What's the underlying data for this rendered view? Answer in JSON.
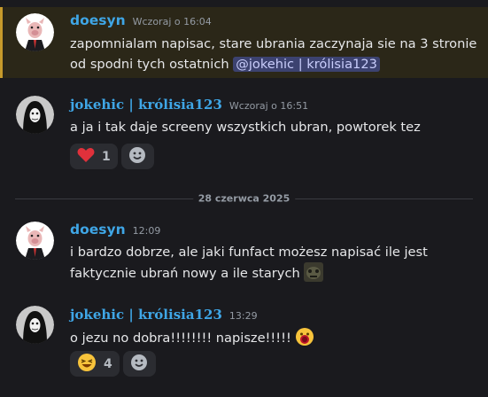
{
  "messages": [
    {
      "author": "doesyn",
      "time": "Wczoraj o 16:04",
      "text": "zapomnialam napisac, stare ubrania zaczynaja sie na 3 stronie od spodni tych ostatnich ",
      "mention": "@jokehic | królisia123"
    },
    {
      "author": "jokehic | królisia123",
      "time": "Wczoraj o 16:51",
      "text": "a ja i tak daje screeny wszystkich ubran, powtorek tez",
      "reactions": [
        {
          "emoji": "heart",
          "count": "1"
        }
      ]
    },
    {
      "author": "doesyn",
      "time": "12:09",
      "text": "i bardzo dobrze, ale jaki funfact możesz napisać ile jest faktycznie ubrań nowy a ile starych",
      "trailing_emoji": "custom-meme-emoji"
    },
    {
      "author": "jokehic | królisia123",
      "time": "13:29",
      "text": "o jezu no dobra!!!!!!!! napisze!!!!! ",
      "trailing_emoji": "screaming-face-emoji",
      "reactions": [
        {
          "emoji": "laughing-face",
          "count": "4"
        }
      ]
    }
  ],
  "divider": {
    "label": "28 czerwca 2025"
  },
  "colors": {
    "background": "#1a1a1e",
    "username": "#3fa6e6",
    "mention_bg": "#3c4270",
    "highlight_bar": "#c69a2b"
  }
}
